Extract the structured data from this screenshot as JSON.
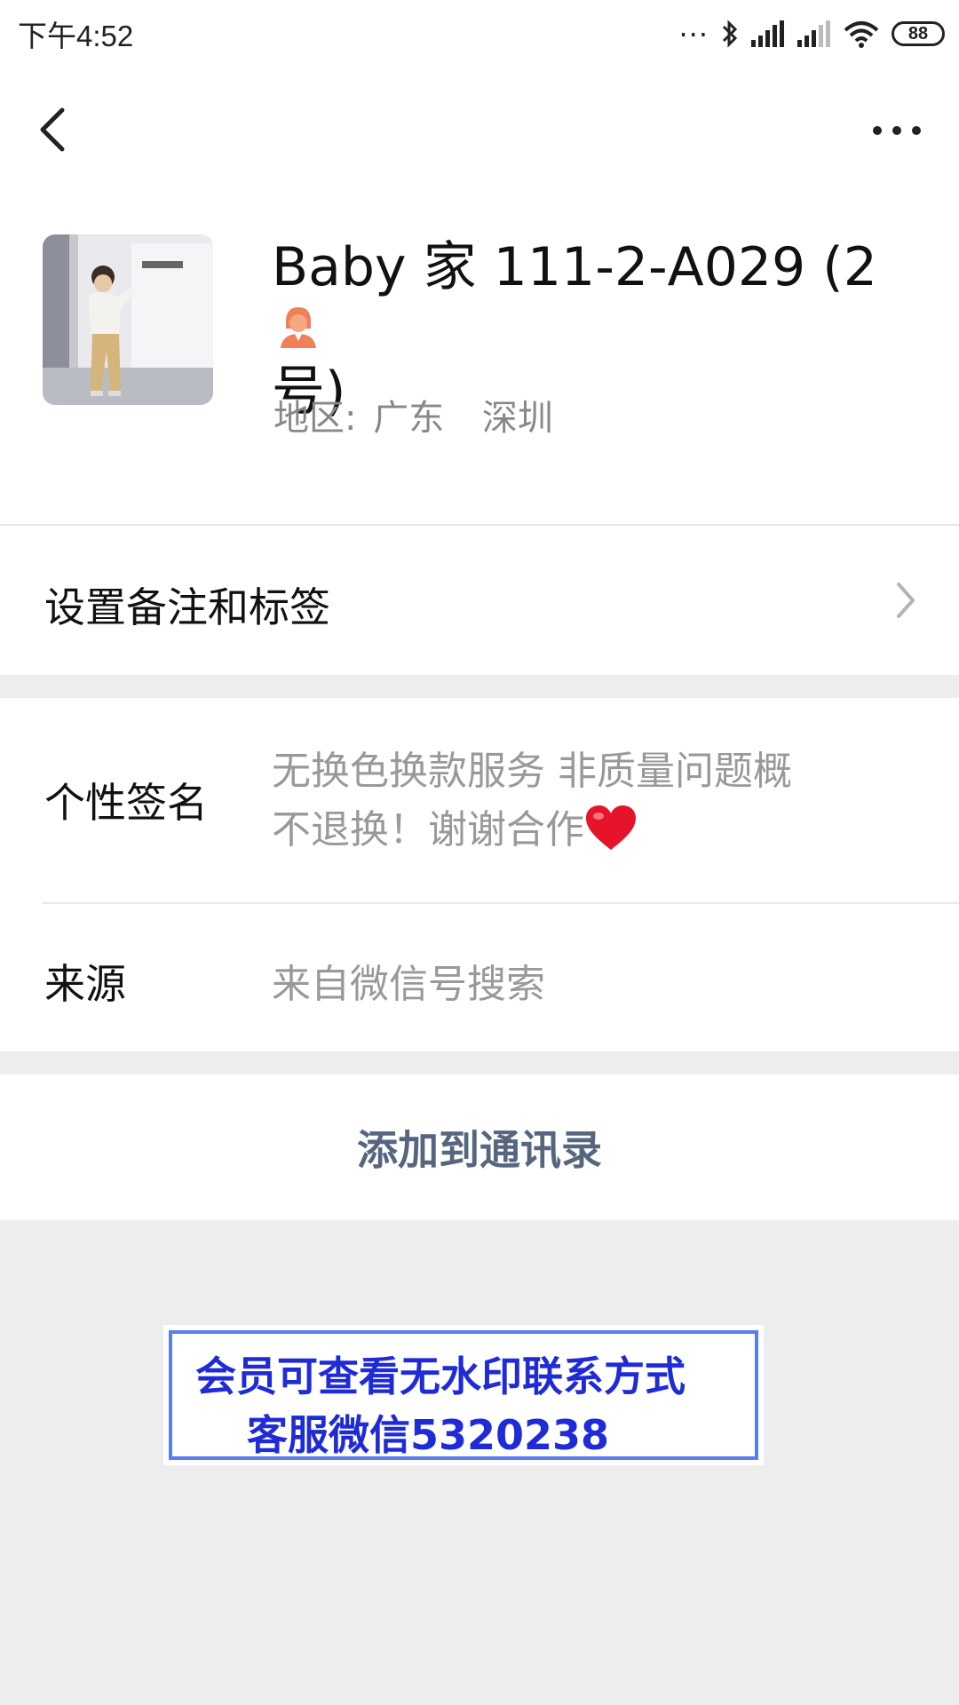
{
  "status_bar": {
    "time": "下午4:52",
    "dots": "...",
    "battery": "88",
    "icons": [
      "bluetooth-icon",
      "signal-icon",
      "signal-weak-icon",
      "wifi-icon",
      "battery-icon"
    ]
  },
  "nav": {
    "back_icon": "chevron-left-icon",
    "more_icon": "more-dots-icon"
  },
  "profile": {
    "name": "Baby 家 111-2-A029 (2号)",
    "name_line1": "Baby 家 111-2-A029 (2",
    "name_line2": "号)",
    "gender_icon": "female-person-icon",
    "region_label": "地区:",
    "region_province": "广东",
    "region_city": "深圳"
  },
  "remark": {
    "label": "设置备注和标签"
  },
  "signature": {
    "label": "个性签名",
    "line1": "无换色换款服务 非质量问题概",
    "line2": "不退换！谢谢合作",
    "emoji": "heart-icon"
  },
  "source": {
    "label": "来源",
    "value": "来自微信号搜索"
  },
  "actions": {
    "add_to_contacts": "添加到通讯录"
  },
  "watermark": {
    "line1": "会员可查看无水印联系方式",
    "line2": "客服微信5320238"
  },
  "colors": {
    "background": "#ededed",
    "action_text": "#56667e",
    "watermark_text": "#1f2bd6",
    "watermark_border": "#5a7df0",
    "gender_icon": "#f0805a"
  }
}
